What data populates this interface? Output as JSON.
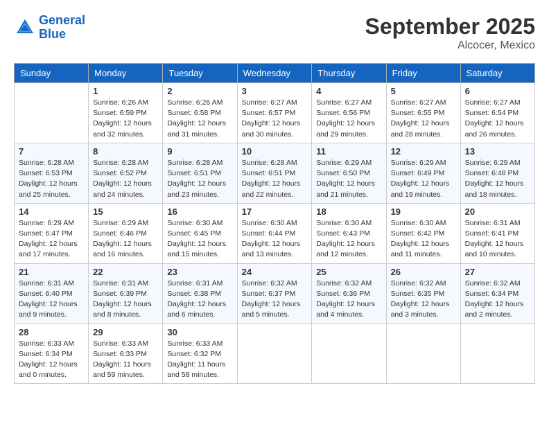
{
  "header": {
    "logo_line1": "General",
    "logo_line2": "Blue",
    "month_title": "September 2025",
    "location": "Alcocer, Mexico"
  },
  "days_of_week": [
    "Sunday",
    "Monday",
    "Tuesday",
    "Wednesday",
    "Thursday",
    "Friday",
    "Saturday"
  ],
  "weeks": [
    [
      {
        "day": "",
        "info": ""
      },
      {
        "day": "1",
        "info": "Sunrise: 6:26 AM\nSunset: 6:59 PM\nDaylight: 12 hours\nand 32 minutes."
      },
      {
        "day": "2",
        "info": "Sunrise: 6:26 AM\nSunset: 6:58 PM\nDaylight: 12 hours\nand 31 minutes."
      },
      {
        "day": "3",
        "info": "Sunrise: 6:27 AM\nSunset: 6:57 PM\nDaylight: 12 hours\nand 30 minutes."
      },
      {
        "day": "4",
        "info": "Sunrise: 6:27 AM\nSunset: 6:56 PM\nDaylight: 12 hours\nand 29 minutes."
      },
      {
        "day": "5",
        "info": "Sunrise: 6:27 AM\nSunset: 6:55 PM\nDaylight: 12 hours\nand 28 minutes."
      },
      {
        "day": "6",
        "info": "Sunrise: 6:27 AM\nSunset: 6:54 PM\nDaylight: 12 hours\nand 26 minutes."
      }
    ],
    [
      {
        "day": "7",
        "info": "Sunrise: 6:28 AM\nSunset: 6:53 PM\nDaylight: 12 hours\nand 25 minutes."
      },
      {
        "day": "8",
        "info": "Sunrise: 6:28 AM\nSunset: 6:52 PM\nDaylight: 12 hours\nand 24 minutes."
      },
      {
        "day": "9",
        "info": "Sunrise: 6:28 AM\nSunset: 6:51 PM\nDaylight: 12 hours\nand 23 minutes."
      },
      {
        "day": "10",
        "info": "Sunrise: 6:28 AM\nSunset: 6:51 PM\nDaylight: 12 hours\nand 22 minutes."
      },
      {
        "day": "11",
        "info": "Sunrise: 6:29 AM\nSunset: 6:50 PM\nDaylight: 12 hours\nand 21 minutes."
      },
      {
        "day": "12",
        "info": "Sunrise: 6:29 AM\nSunset: 6:49 PM\nDaylight: 12 hours\nand 19 minutes."
      },
      {
        "day": "13",
        "info": "Sunrise: 6:29 AM\nSunset: 6:48 PM\nDaylight: 12 hours\nand 18 minutes."
      }
    ],
    [
      {
        "day": "14",
        "info": "Sunrise: 6:29 AM\nSunset: 6:47 PM\nDaylight: 12 hours\nand 17 minutes."
      },
      {
        "day": "15",
        "info": "Sunrise: 6:29 AM\nSunset: 6:46 PM\nDaylight: 12 hours\nand 16 minutes."
      },
      {
        "day": "16",
        "info": "Sunrise: 6:30 AM\nSunset: 6:45 PM\nDaylight: 12 hours\nand 15 minutes."
      },
      {
        "day": "17",
        "info": "Sunrise: 6:30 AM\nSunset: 6:44 PM\nDaylight: 12 hours\nand 13 minutes."
      },
      {
        "day": "18",
        "info": "Sunrise: 6:30 AM\nSunset: 6:43 PM\nDaylight: 12 hours\nand 12 minutes."
      },
      {
        "day": "19",
        "info": "Sunrise: 6:30 AM\nSunset: 6:42 PM\nDaylight: 12 hours\nand 11 minutes."
      },
      {
        "day": "20",
        "info": "Sunrise: 6:31 AM\nSunset: 6:41 PM\nDaylight: 12 hours\nand 10 minutes."
      }
    ],
    [
      {
        "day": "21",
        "info": "Sunrise: 6:31 AM\nSunset: 6:40 PM\nDaylight: 12 hours\nand 9 minutes."
      },
      {
        "day": "22",
        "info": "Sunrise: 6:31 AM\nSunset: 6:39 PM\nDaylight: 12 hours\nand 8 minutes."
      },
      {
        "day": "23",
        "info": "Sunrise: 6:31 AM\nSunset: 6:38 PM\nDaylight: 12 hours\nand 6 minutes."
      },
      {
        "day": "24",
        "info": "Sunrise: 6:32 AM\nSunset: 6:37 PM\nDaylight: 12 hours\nand 5 minutes."
      },
      {
        "day": "25",
        "info": "Sunrise: 6:32 AM\nSunset: 6:36 PM\nDaylight: 12 hours\nand 4 minutes."
      },
      {
        "day": "26",
        "info": "Sunrise: 6:32 AM\nSunset: 6:35 PM\nDaylight: 12 hours\nand 3 minutes."
      },
      {
        "day": "27",
        "info": "Sunrise: 6:32 AM\nSunset: 6:34 PM\nDaylight: 12 hours\nand 2 minutes."
      }
    ],
    [
      {
        "day": "28",
        "info": "Sunrise: 6:33 AM\nSunset: 6:34 PM\nDaylight: 12 hours\nand 0 minutes."
      },
      {
        "day": "29",
        "info": "Sunrise: 6:33 AM\nSunset: 6:33 PM\nDaylight: 11 hours\nand 59 minutes."
      },
      {
        "day": "30",
        "info": "Sunrise: 6:33 AM\nSunset: 6:32 PM\nDaylight: 11 hours\nand 58 minutes."
      },
      {
        "day": "",
        "info": ""
      },
      {
        "day": "",
        "info": ""
      },
      {
        "day": "",
        "info": ""
      },
      {
        "day": "",
        "info": ""
      }
    ]
  ]
}
